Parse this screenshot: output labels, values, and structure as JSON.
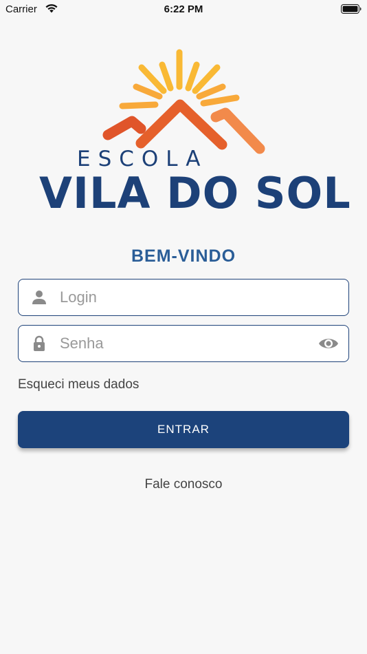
{
  "status_bar": {
    "carrier": "Carrier",
    "time": "6:22 PM",
    "icons": [
      "wifi-icon",
      "battery-icon"
    ]
  },
  "logo": {
    "line1": "ESCOLA",
    "line2": "VILA DO SOL",
    "colors": {
      "sun": "#f8b83c",
      "roof": "#e0552a",
      "text": "#1d4178"
    }
  },
  "welcome": "BEM-VINDO",
  "login_field": {
    "placeholder": "Login",
    "value": "",
    "icon": "user-icon"
  },
  "password_field": {
    "placeholder": "Senha",
    "value": "",
    "icon": "lock-icon",
    "toggle_icon": "eye-icon"
  },
  "forgot_link": "Esqueci meus dados",
  "enter_button": "ENTRAR",
  "contact_link": "Fale conosco",
  "colors": {
    "primary": "#1c437b",
    "accent": "#2a5d97",
    "background": "#f7f7f7"
  }
}
